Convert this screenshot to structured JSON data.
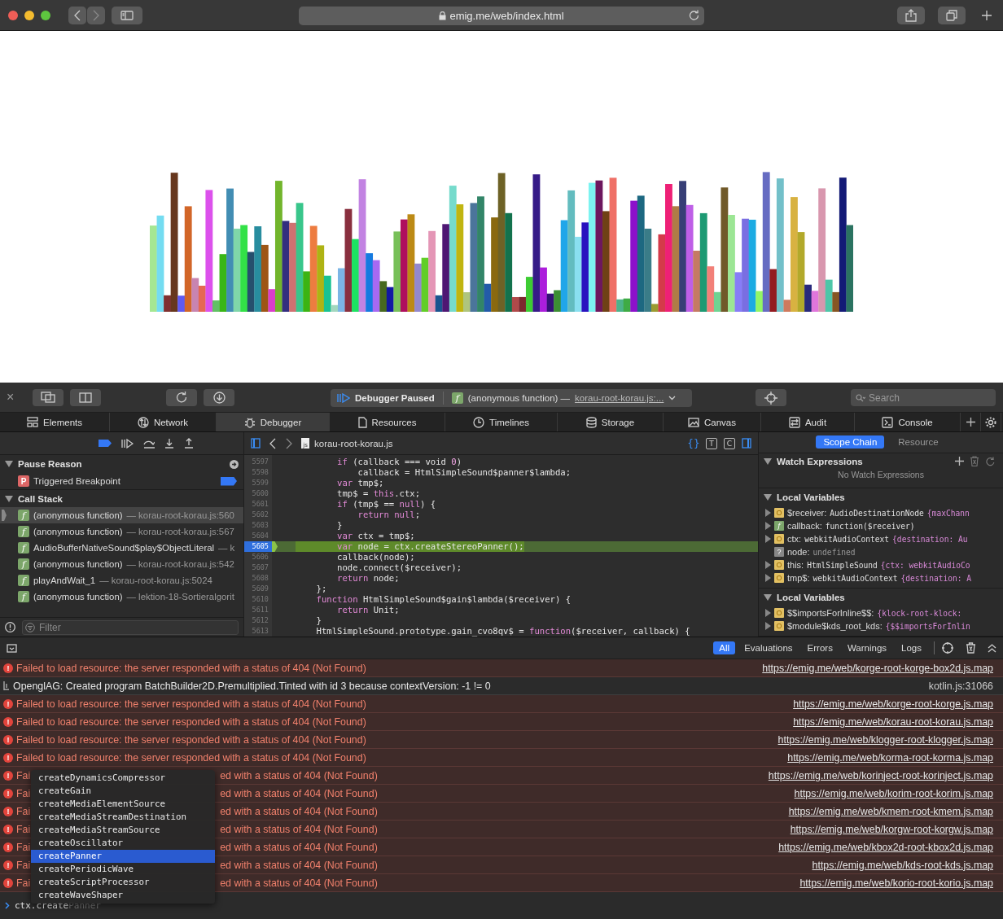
{
  "browser": {
    "url": "emig.me/web/index.html"
  },
  "devtools": {
    "toolbar": {
      "close": "×",
      "status": "Debugger Paused",
      "frame_badge": "f",
      "frame_name": "(anonymous function) —",
      "frame_link": "korau-root-korau.js:...",
      "search_placeholder": "Search"
    },
    "tabs": [
      {
        "label": "Elements",
        "selected": false
      },
      {
        "label": "Network",
        "selected": false
      },
      {
        "label": "Debugger",
        "selected": true
      },
      {
        "label": "Resources",
        "selected": false
      },
      {
        "label": "Timelines",
        "selected": false
      },
      {
        "label": "Storage",
        "selected": false
      },
      {
        "label": "Canvas",
        "selected": false
      },
      {
        "label": "Audit",
        "selected": false
      },
      {
        "label": "Console",
        "selected": false
      }
    ],
    "sidebar": {
      "pause_reason": {
        "title": "Pause Reason",
        "badge": "P",
        "reason": "Triggered Breakpoint"
      },
      "call_stack": {
        "title": "Call Stack",
        "frames": [
          {
            "badge": "f",
            "name": "(anonymous function)",
            "location": "— korau-root-korau.js:560",
            "selected": true
          },
          {
            "badge": "f",
            "name": "(anonymous function)",
            "location": "— korau-root-korau.js:567",
            "selected": false
          },
          {
            "badge": "f",
            "name": "AudioBufferNativeSound$play$ObjectLiteral",
            "location": "— k",
            "selected": false
          },
          {
            "badge": "f",
            "name": "(anonymous function)",
            "location": "— korau-root-korau.js:542",
            "selected": false
          },
          {
            "badge": "f",
            "name": "playAndWait_1",
            "location": "— korau-root-korau.js:5024",
            "selected": false
          },
          {
            "badge": "f",
            "name": "(anonymous function)",
            "location": "— lektion-18-Sortieralgorit",
            "selected": false
          }
        ]
      },
      "filter_placeholder": "Filter"
    },
    "editor": {
      "file": "korau-root-korau.js",
      "file_badge": "js",
      "buttons": [
        "{}",
        "T",
        "C"
      ],
      "lines": [
        {
          "number": "5597",
          "current": false,
          "tokens": [
            {
              "t": "        if",
              "kind": "keyword"
            },
            {
              "t": " (callback === void "
            },
            {
              "t": "0",
              "kind": "number"
            },
            {
              "t": ")"
            }
          ]
        },
        {
          "number": "5598",
          "current": false,
          "tokens": [
            {
              "t": "            callback = HtmlSimpleSound$panner$lambda;"
            }
          ]
        },
        {
          "number": "5599",
          "current": false,
          "tokens": [
            {
              "t": "        var",
              "kind": "keyword"
            },
            {
              "t": " tmp$;"
            }
          ]
        },
        {
          "number": "5600",
          "current": false,
          "tokens": [
            {
              "t": "        tmp$ = "
            },
            {
              "t": "this",
              "kind": "keyword"
            },
            {
              "t": ".ctx;"
            }
          ]
        },
        {
          "number": "5601",
          "current": false,
          "tokens": [
            {
              "t": "        if",
              "kind": "keyword"
            },
            {
              "t": " (tmp$ == "
            },
            {
              "t": "null",
              "kind": "keyword"
            },
            {
              "t": ") {"
            }
          ]
        },
        {
          "number": "5602",
          "current": false,
          "tokens": [
            {
              "t": "            return null",
              "kind": "keyword"
            },
            {
              "t": ";"
            }
          ]
        },
        {
          "number": "5603",
          "current": false,
          "tokens": [
            {
              "t": "        }"
            }
          ]
        },
        {
          "number": "5604",
          "current": false,
          "tokens": [
            {
              "t": "        var",
              "kind": "keyword"
            },
            {
              "t": " ctx = tmp$;"
            }
          ]
        },
        {
          "number": "5605",
          "current": true,
          "tokens": [
            {
              "t": "        var",
              "kind": "keyword"
            },
            {
              "t": " node = ctx.createStereoPanner();"
            }
          ]
        },
        {
          "number": "5606",
          "current": false,
          "tokens": [
            {
              "t": "        callback(node);"
            }
          ]
        },
        {
          "number": "5607",
          "current": false,
          "tokens": [
            {
              "t": "        node.connect($receiver);"
            }
          ]
        },
        {
          "number": "5608",
          "current": false,
          "tokens": [
            {
              "t": "        return",
              "kind": "keyword"
            },
            {
              "t": " node;"
            }
          ]
        },
        {
          "number": "5609",
          "current": false,
          "tokens": [
            {
              "t": "    };"
            }
          ]
        },
        {
          "number": "5610",
          "current": false,
          "tokens": [
            {
              "t": "    function",
              "kind": "keyword"
            },
            {
              "t": " HtmlSimpleSound$gain$lambda($receiver) {"
            }
          ]
        },
        {
          "number": "5611",
          "current": false,
          "tokens": [
            {
              "t": "        return",
              "kind": "keyword"
            },
            {
              "t": " Unit;"
            }
          ]
        },
        {
          "number": "5612",
          "current": false,
          "tokens": [
            {
              "t": "    }"
            }
          ]
        },
        {
          "number": "5613",
          "current": false,
          "tokens": [
            {
              "t": "    HtmlSimpleSound.prototype.gain_cvo8qv$ = "
            },
            {
              "t": "function",
              "kind": "keyword"
            },
            {
              "t": "($receiver, callback) {"
            }
          ]
        }
      ]
    },
    "details": {
      "tabs": [
        {
          "label": "Scope Chain",
          "selected": true
        },
        {
          "label": "Resource",
          "selected": false
        }
      ],
      "watch": {
        "title": "Watch Expressions",
        "empty": "No Watch Expressions"
      },
      "scopes": [
        {
          "title": "Local Variables",
          "variables": [
            {
              "kind": "object",
              "badge": "O",
              "expandable": true,
              "name": "$receiver:",
              "value": "AudioDestinationNode",
              "preview": "{maxChann"
            },
            {
              "kind": "function",
              "badge": "f",
              "expandable": true,
              "name": "callback:",
              "value": "function($receiver)"
            },
            {
              "kind": "object",
              "badge": "O",
              "expandable": true,
              "name": "ctx:",
              "value": "webkitAudioContext",
              "preview": "{destination: Au"
            },
            {
              "kind": "undefined",
              "badge": "?",
              "expandable": false,
              "name": "node:",
              "value": "undefined"
            },
            {
              "kind": "object",
              "badge": "O",
              "expandable": true,
              "name": "this:",
              "value": "HtmlSimpleSound",
              "preview": "{ctx: webkitAudioCo"
            },
            {
              "kind": "object",
              "badge": "O",
              "expandable": true,
              "name": "tmp$:",
              "value": "webkitAudioContext",
              "preview": "{destination: A"
            }
          ]
        },
        {
          "title": "Local Variables",
          "variables": [
            {
              "kind": "object",
              "badge": "O",
              "expandable": true,
              "name": "$$importsForInline$$:",
              "preview": "{klock-root-klock:"
            },
            {
              "kind": "object",
              "badge": "O",
              "expandable": true,
              "name": "$module$kds_root_kds:",
              "preview": "{$$importsForInlin"
            }
          ]
        }
      ]
    }
  },
  "console": {
    "filters": [
      {
        "label": "All",
        "selected": true
      },
      {
        "label": "Evaluations",
        "selected": false
      },
      {
        "label": "Errors",
        "selected": false
      },
      {
        "label": "Warnings",
        "selected": false
      },
      {
        "label": "Logs",
        "selected": false
      }
    ],
    "messages": [
      {
        "kind": "error",
        "icon": "!",
        "text": "Failed to load resource: the server responded with a status of 404 (Not Found)",
        "source": "https://emig.me/web/korge-root-korge-box2d.js.map"
      },
      {
        "kind": "log",
        "text": "OpenglAG: Created program BatchBuilder2D.Premultiplied.Tinted with id 3 because contextVersion: -1 != 0",
        "source": "kotlin.js:31066"
      },
      {
        "kind": "error",
        "icon": "!",
        "text": "Failed to load resource: the server responded with a status of 404 (Not Found)",
        "source": "https://emig.me/web/korge-root-korge.js.map"
      },
      {
        "kind": "error",
        "icon": "!",
        "text": "Failed to load resource: the server responded with a status of 404 (Not Found)",
        "source": "https://emig.me/web/korau-root-korau.js.map"
      },
      {
        "kind": "error",
        "icon": "!",
        "text": "Failed to load resource: the server responded with a status of 404 (Not Found)",
        "source": "https://emig.me/web/klogger-root-klogger.js.map"
      },
      {
        "kind": "error",
        "icon": "!",
        "text": "Failed to load resource: the server responded with a status of 404 (Not Found)",
        "source": "https://emig.me/web/korma-root-korma.js.map"
      },
      {
        "kind": "error",
        "icon": "!",
        "text": "Fai",
        "text_after": "ed with a status of 404 (Not Found)",
        "source": "https://emig.me/web/korinject-root-korinject.js.map"
      },
      {
        "kind": "error",
        "icon": "!",
        "text": "Fai",
        "text_after": "ed with a status of 404 (Not Found)",
        "source": "https://emig.me/web/korim-root-korim.js.map"
      },
      {
        "kind": "error",
        "icon": "!",
        "text": "Fai",
        "text_after": "ed with a status of 404 (Not Found)",
        "source": "https://emig.me/web/kmem-root-kmem.js.map"
      },
      {
        "kind": "error",
        "icon": "!",
        "text": "Fai",
        "text_after": "ed with a status of 404 (Not Found)",
        "source": "https://emig.me/web/korgw-root-korgw.js.map"
      },
      {
        "kind": "error",
        "icon": "!",
        "text": "Fai",
        "text_after": "ed with a status of 404 (Not Found)",
        "source": "https://emig.me/web/kbox2d-root-kbox2d.js.map"
      },
      {
        "kind": "error",
        "icon": "!",
        "text": "Fai",
        "text_after": "ed with a status of 404 (Not Found)",
        "source": "https://emig.me/web/kds-root-kds.js.map"
      },
      {
        "kind": "error",
        "icon": "!",
        "text": "Fai",
        "text_after": "ed with a status of 404 (Not Found)",
        "source": "https://emig.me/web/korio-root-korio.js.map"
      }
    ],
    "completions": [
      {
        "label": "createDynamicsCompressor",
        "selected": false
      },
      {
        "label": "createGain",
        "selected": false
      },
      {
        "label": "createMediaElementSource",
        "selected": false
      },
      {
        "label": "createMediaStreamDestination",
        "selected": false
      },
      {
        "label": "createMediaStreamSource",
        "selected": false
      },
      {
        "label": "createOscillator",
        "selected": false
      },
      {
        "label": "createPanner",
        "selected": true
      },
      {
        "label": "createPeriodicWave",
        "selected": false
      },
      {
        "label": "createScriptProcessor",
        "selected": false
      },
      {
        "label": "createWaveShaper",
        "selected": false
      }
    ],
    "prompt": {
      "value": "ctx.create",
      "suggestion": "Panner"
    }
  }
}
